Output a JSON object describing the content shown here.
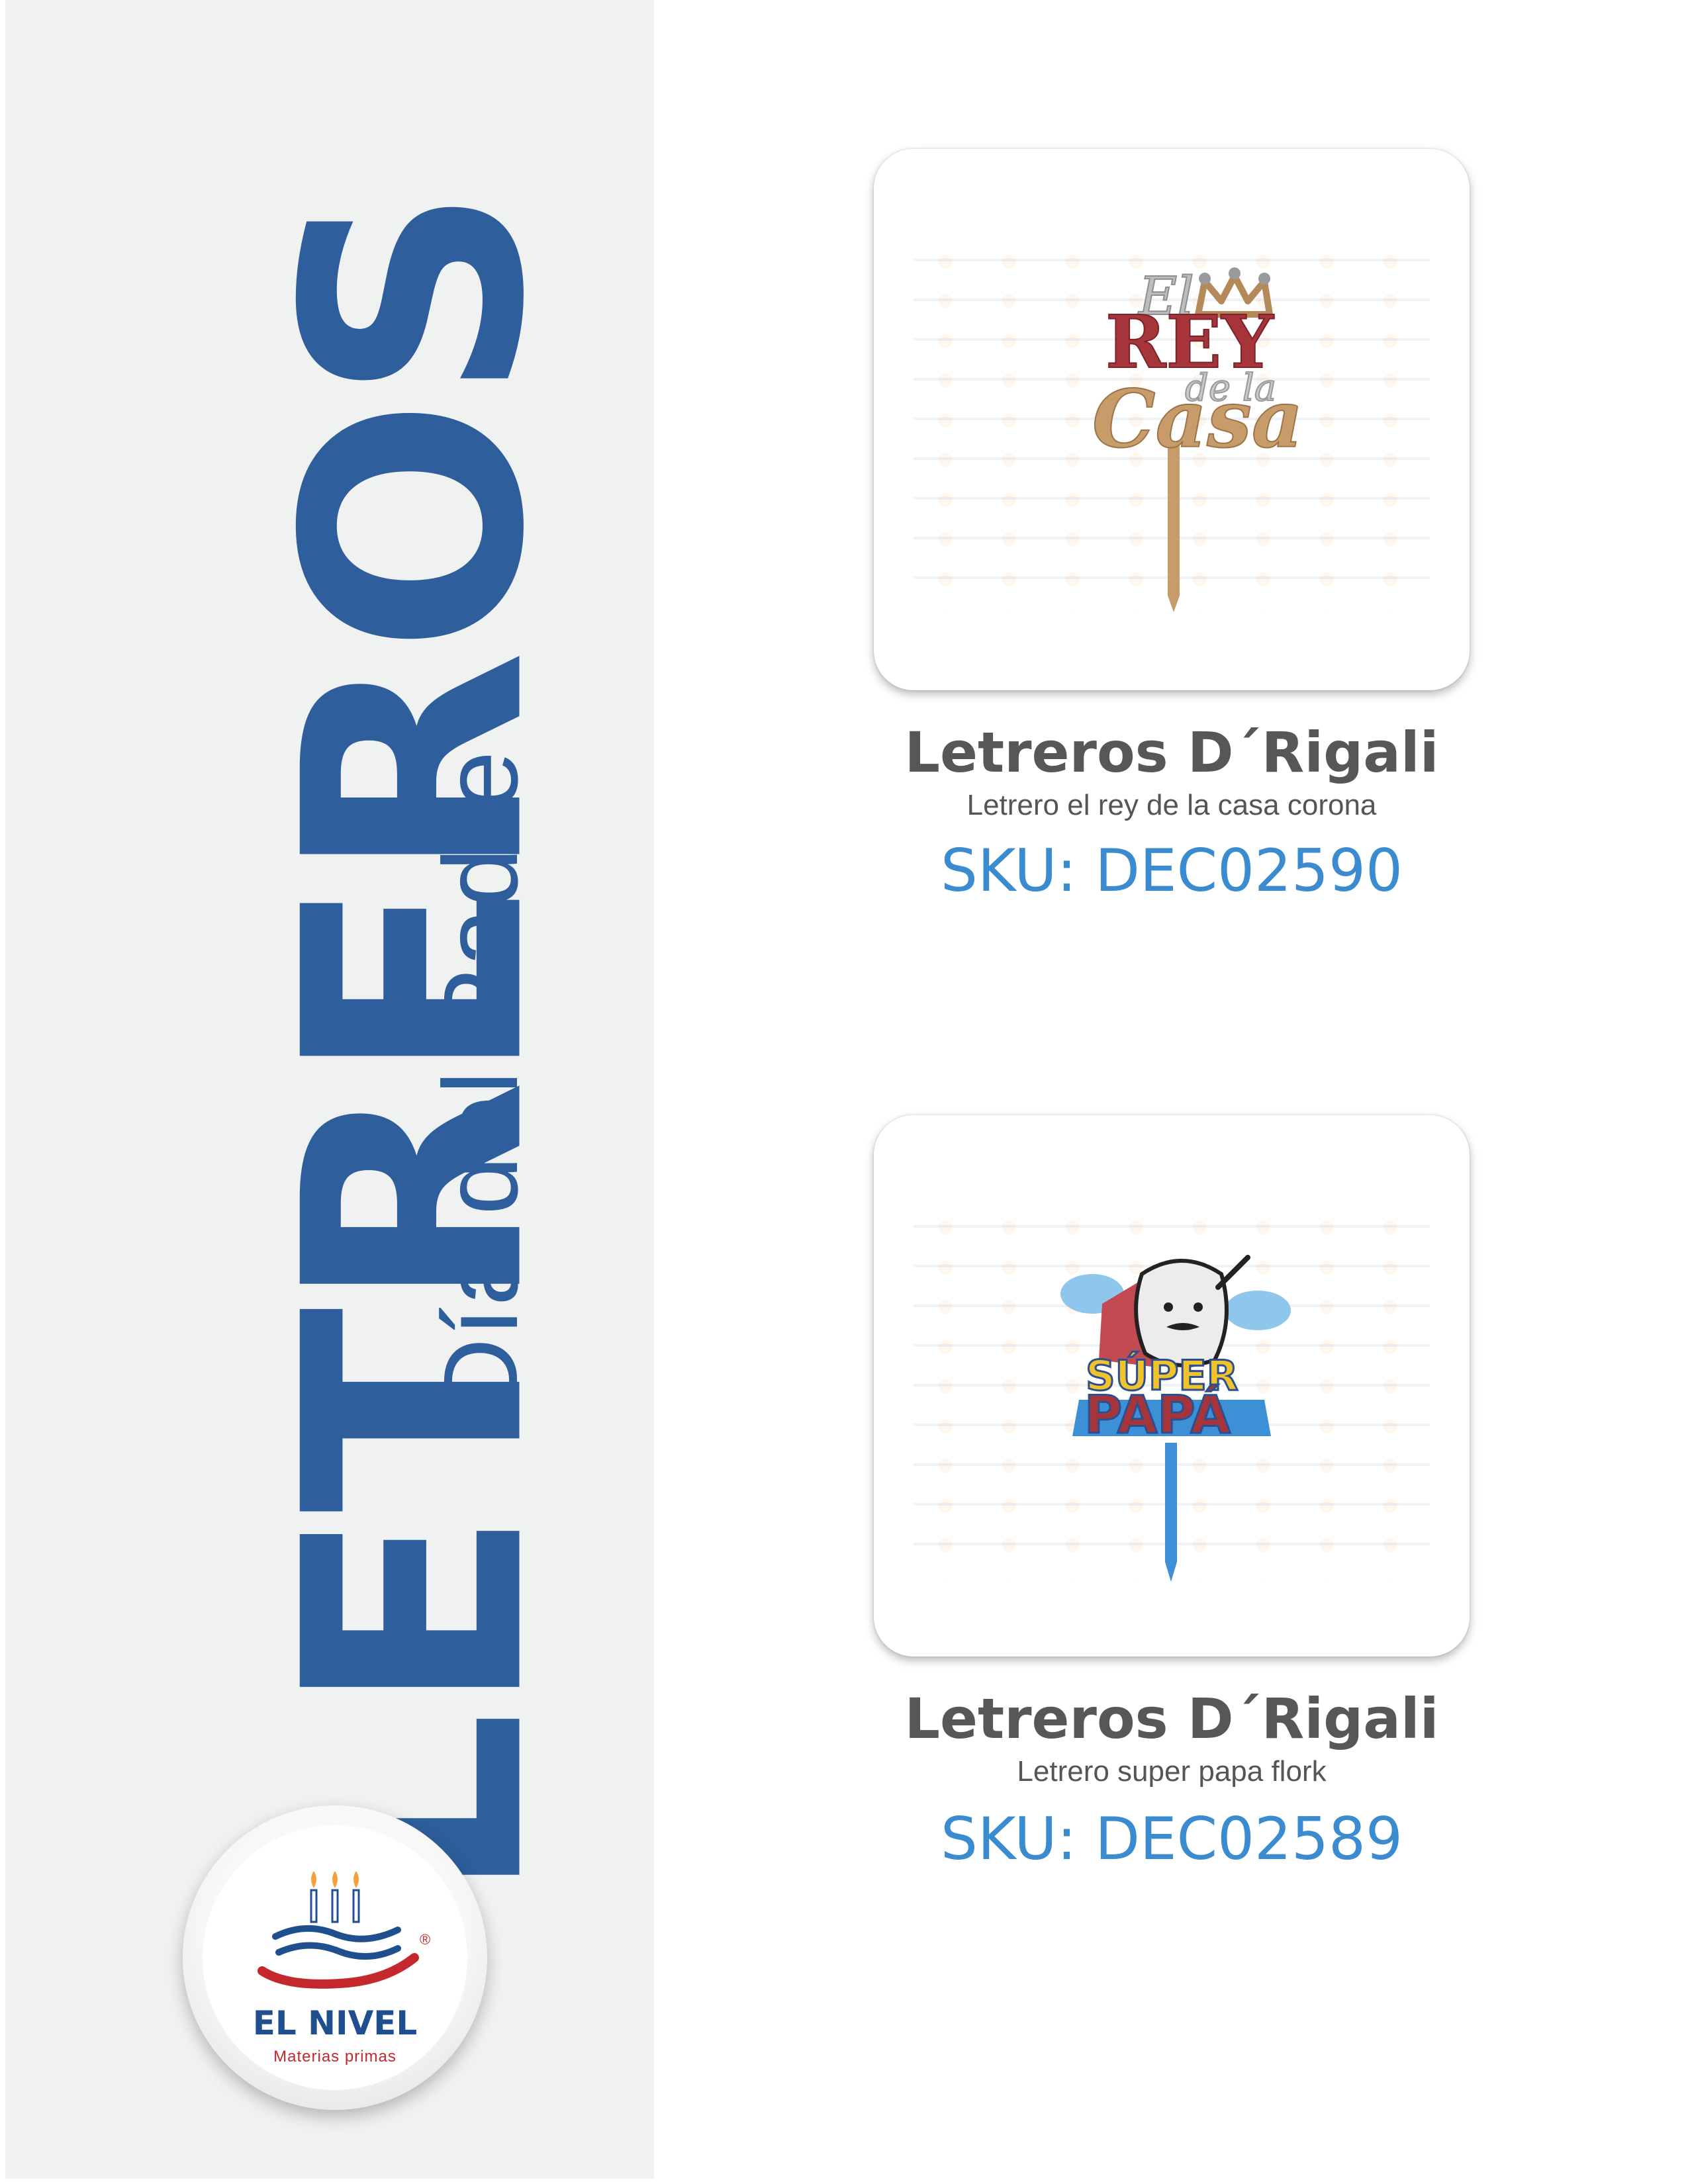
{
  "sidebar": {
    "title": "LETREROS",
    "subtitle": "Día del Padre",
    "accent_color": "#2e5f9c",
    "background": "#f0f2f2"
  },
  "logo": {
    "name": "EL NIVEL",
    "tagline": "Materias primas",
    "registered": "®",
    "icon": "cake-candles-logo"
  },
  "products": [
    {
      "brand": "Letreros D´Rigali",
      "description": "Letrero el rey de la casa corona",
      "sku": "SKU: DEC02590",
      "image_lettering": [
        "El",
        "REY",
        "de la",
        "Casa"
      ],
      "icon": "crown-icon"
    },
    {
      "brand": "Letreros D´Rigali",
      "description": "Letrero super papa flork",
      "sku": "SKU: DEC02589",
      "image_lettering": [
        "SÚPER",
        "PAPÁ"
      ],
      "icon": "flork-character-icon"
    }
  ],
  "colors": {
    "brand_text": "#575757",
    "sku_text": "#3a8bd0",
    "logo_red": "#c4282c",
    "logo_blue": "#1f4f8f"
  }
}
